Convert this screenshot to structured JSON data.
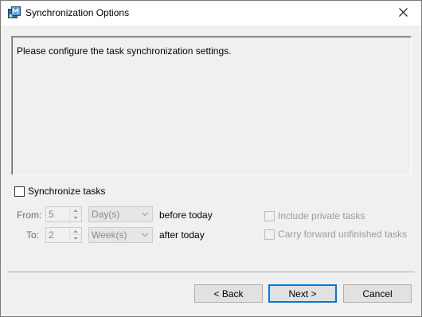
{
  "window": {
    "title": "Synchronization Options",
    "app_icon": "app-logo-icon",
    "close_icon": "close-icon"
  },
  "info": {
    "text": "Please configure the task synchronization settings."
  },
  "sync": {
    "checkbox_label": "Synchronize tasks",
    "checked": false
  },
  "from": {
    "label": "From:",
    "value": "5",
    "unit": "Day(s)",
    "suffix": "before today"
  },
  "to": {
    "label": "To:",
    "value": "2",
    "unit": "Week(s)",
    "suffix": "after today"
  },
  "options": {
    "include_private": "Include private tasks",
    "carry_forward": "Carry forward unfinished tasks"
  },
  "buttons": {
    "back": "< Back",
    "next": "Next >",
    "cancel": "Cancel"
  },
  "colors": {
    "accent": "#0078d7",
    "dialog_bg": "#f0f0f0",
    "disabled_text": "#9b9b9b"
  }
}
